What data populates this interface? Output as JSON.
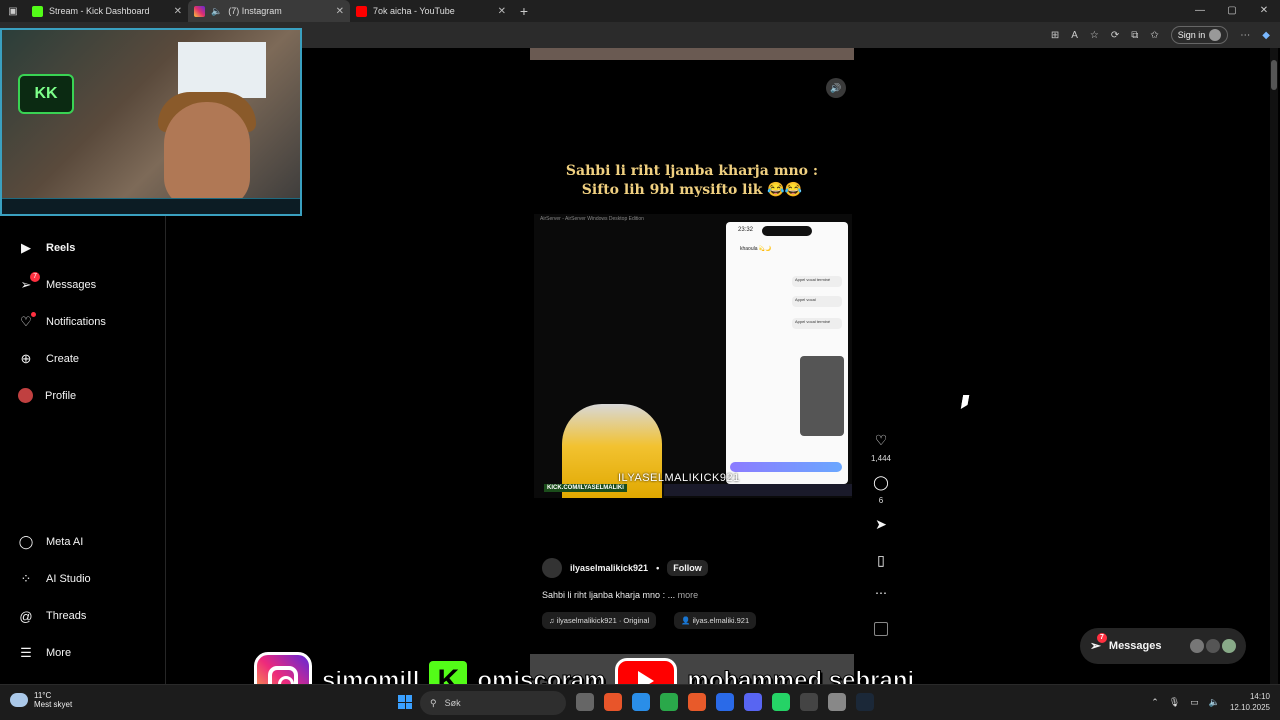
{
  "browser": {
    "tabs": [
      {
        "label": "Stream - Kick Dashboard",
        "color": "#53fc18",
        "active": false
      },
      {
        "label": "(7) Instagram",
        "color": "#e1306c",
        "active": true
      },
      {
        "label": "7ok aicha - YouTube",
        "color": "#ff0000",
        "active": false
      }
    ],
    "sign_in": "Sign in"
  },
  "sidebar": {
    "items": [
      {
        "label": "Reels",
        "icon": "reels-icon"
      },
      {
        "label": "Messages",
        "icon": "messenger-icon",
        "badge": "7"
      },
      {
        "label": "Notifications",
        "icon": "heart-icon"
      },
      {
        "label": "Create",
        "icon": "plus-square-icon"
      },
      {
        "label": "Profile",
        "icon": "avatar"
      },
      {
        "label": "Meta AI",
        "icon": "meta-ai-icon"
      },
      {
        "label": "AI Studio",
        "icon": "ai-studio-icon"
      },
      {
        "label": "Threads",
        "icon": "threads-icon"
      },
      {
        "label": "More",
        "icon": "hamburger-icon"
      }
    ]
  },
  "reel": {
    "caption_line1": "Sahbi li riht ljanba kharja mno :",
    "caption_line2": "Sifto lih 9bl mysifto lik 😂😂",
    "clip_title": "AirServer - AirServer Windows Desktop Edition",
    "phone_time": "23:32",
    "phone_contact": "khaoula 💫🌙",
    "bubbles": [
      "Appel vocal terminé",
      "Appel vocal",
      "Appel vocal terminé"
    ],
    "kick_tag": "KICK.COM/ILYASELMALIKI",
    "watermark": "ILYASELMALIKICK921",
    "author": "ilyaselmalikick921",
    "follow_label": "Follow",
    "text": "Sahbi li riht ljanba kharja mno : ...",
    "more_label": "more",
    "audio_chip": "ilyaselmalikick921 · Original",
    "user_chip": "ilyas.elmaliki.921",
    "likes": "1,444",
    "comments": "6"
  },
  "messages_pill": {
    "label": "Messages",
    "badge": "7"
  },
  "overlay": {
    "names": [
      "simomill",
      "omiscoram",
      "mohammed sebrani"
    ]
  },
  "taskbar": {
    "temperature": "11°C",
    "weather": "Mest skyet",
    "search_placeholder": "Søk",
    "time": "14:10",
    "date": "12.10.2025"
  }
}
